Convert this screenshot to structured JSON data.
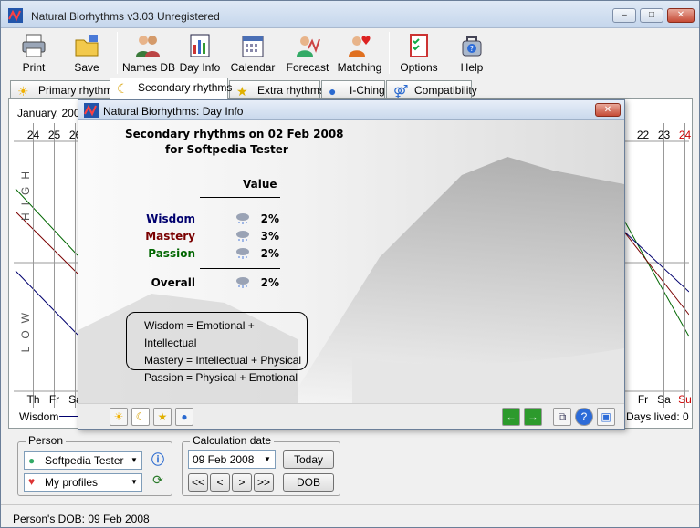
{
  "window": {
    "title": "Natural Biorhythms v3.03 Unregistered",
    "min": "‒",
    "max": "□",
    "close": "✕"
  },
  "toolbar": [
    {
      "label": "Print",
      "icon": "printer-icon"
    },
    {
      "label": "Save",
      "icon": "folder-save-icon"
    },
    {
      "label": "Names DB",
      "icon": "people-icon"
    },
    {
      "label": "Day Info",
      "icon": "day-chart-icon"
    },
    {
      "label": "Calendar",
      "icon": "calendar-icon"
    },
    {
      "label": "Forecast",
      "icon": "forecast-person-icon"
    },
    {
      "label": "Matching",
      "icon": "matching-heart-icon"
    },
    {
      "label": "Options",
      "icon": "options-checklist-icon"
    },
    {
      "label": "Help",
      "icon": "help-icon"
    }
  ],
  "tabs": [
    "Primary rhythms",
    "Secondary rhythms",
    "Extra rhythms",
    "I-Ching",
    "Compatibility"
  ],
  "chart": {
    "month_label": "January, 2008",
    "left_days": [
      {
        "n": "24",
        "w": "Th"
      },
      {
        "n": "25",
        "w": "Fr"
      },
      {
        "n": "26",
        "w": "Sa"
      }
    ],
    "right_days": [
      {
        "n": "22",
        "w": "Fr"
      },
      {
        "n": "23",
        "w": "Sa"
      },
      {
        "n": "24",
        "w": "Su"
      }
    ],
    "high_label": "HIGH",
    "low_label": "LOW",
    "legend_first": "Wisdom",
    "days_lived": "Days lived: 0"
  },
  "person": {
    "caption": "Person",
    "name": "Softpedia Tester",
    "profiles": "My profiles"
  },
  "calc": {
    "caption": "Calculation date",
    "date": "09 Feb 2008",
    "today": "Today",
    "dob": "DOB",
    "nav": [
      "<<",
      "<",
      ">",
      ">>"
    ]
  },
  "status": "Person's DOB: 09 Feb 2008",
  "dialog": {
    "title": "Natural Biorhythms: Day Info",
    "heading": "Secondary rhythms on 02 Feb 2008",
    "subheading": "for Softpedia Tester",
    "value_header": "Value",
    "rows": [
      {
        "name": "Wisdom",
        "value": "2%",
        "color": "#00006e"
      },
      {
        "name": "Mastery",
        "value": "3%",
        "color": "#7a0000"
      },
      {
        "name": "Passion",
        "value": "2%",
        "color": "#006600"
      }
    ],
    "overall": {
      "name": "Overall",
      "value": "2%"
    },
    "legend": [
      "Wisdom = Emotional + Intellectual",
      "Mastery = Intellectual + Physical",
      "Passion = Physical + Emotional"
    ]
  },
  "colors": {
    "wisdom": "#00006e",
    "mastery": "#7a0000",
    "passion": "#006600",
    "sunday": "#cc0000"
  }
}
